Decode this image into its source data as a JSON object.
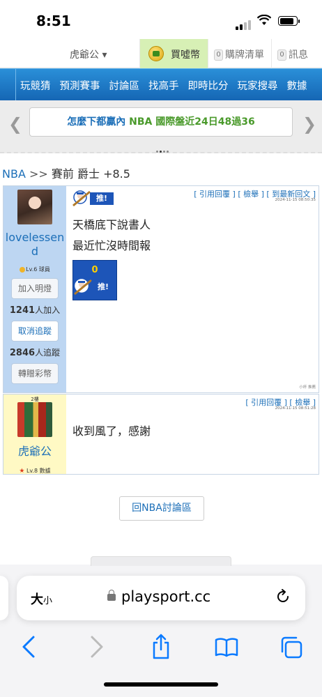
{
  "status_bar": {
    "time": "8:51"
  },
  "user_bar": {
    "username": "虎爺公 ▾",
    "buy_coins": "買噓幣",
    "cart_count": "0",
    "cart_label": "購牌清單",
    "msg_count": "0",
    "msg_label": "訊息"
  },
  "nav": {
    "items": [
      "玩競猜",
      "預測賽事",
      "討論區",
      "找高手",
      "即時比分",
      "玩家搜尋",
      "數據"
    ]
  },
  "banner": {
    "text_a": "怎麼下都贏內",
    "text_b": "NBA 國際盤近24日48過36"
  },
  "breadcrumb": {
    "section": "NBA",
    "sep": ">>",
    "title": "賽前 爵士 +8.5"
  },
  "posts": [
    {
      "username": "lovelessend",
      "level": "Lv.6 球員",
      "buttons": {
        "add_light": "加入明燈",
        "unfollow": "取消追蹤",
        "gift": "轉贈彩幣"
      },
      "light_count": "1241",
      "light_label": "人加入",
      "follow_count": "2846",
      "follow_label": "人追蹤",
      "tools": {
        "quote": "[ 引用回覆 ]",
        "report": "[ 檢舉 ]",
        "latest": "[ 到最新回文 ]"
      },
      "timestamp": "2024-11-15 08:50:35",
      "push_label": "推!",
      "lines": [
        "天橋底下說書人",
        "最近忙沒時間報"
      ],
      "push_count": "0",
      "reply_note": "小杯 推薦"
    },
    {
      "floor": "2樓",
      "username": "虎爺公",
      "level": "Lv.8 數據",
      "tools": {
        "quote": "[ 引用回覆 ]",
        "report": "[ 檢舉 ]"
      },
      "timestamp": "2024-11-15 08:51:28",
      "text": "收到風了，感謝"
    }
  ],
  "back_button": "回NBA討論區",
  "browser": {
    "text_size_big": "大",
    "text_size_small": "小",
    "url": "playsport.cc"
  }
}
